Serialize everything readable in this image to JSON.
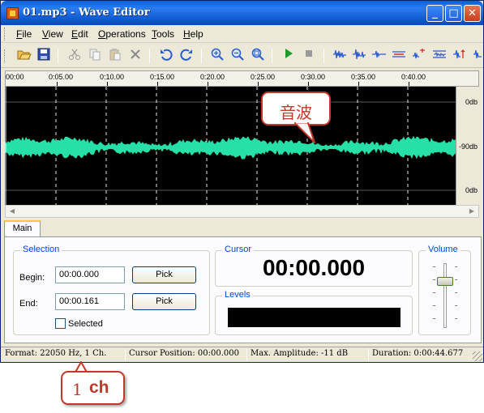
{
  "window": {
    "title": "01.mp3 - Wave Editor",
    "buttons": {
      "minimize": "_",
      "maximize": "□",
      "close": "✕"
    }
  },
  "menu": [
    {
      "label": "File",
      "accel": "F",
      "rest": "ile"
    },
    {
      "label": "View",
      "accel": "V",
      "rest": "iew"
    },
    {
      "label": "Edit",
      "accel": "E",
      "rest": "dit"
    },
    {
      "label": "Operations",
      "accel": "O",
      "rest": "perations"
    },
    {
      "label": "Tools",
      "accel": "T",
      "rest": "ools"
    },
    {
      "label": "Help",
      "accel": "H",
      "rest": "elp"
    }
  ],
  "toolbar": {
    "icons": [
      "open-icon",
      "save-icon",
      "cut-icon",
      "copy-icon",
      "paste-icon",
      "delete-icon",
      "undo-icon",
      "redo-icon",
      "zoom-in-icon",
      "zoom-out-icon",
      "zoom-fit-icon",
      "play-icon",
      "stop-icon",
      "wave-effect-icon"
    ]
  },
  "ruler": {
    "ticks": [
      "00:00",
      "0:05.00",
      "0:10.00",
      "0:15.00",
      "0:20.00",
      "0:25.00",
      "0:30.00",
      "0:35.00",
      "0:40.00"
    ]
  },
  "waveform": {
    "color": "#27e0a8",
    "db_labels": [
      "0db",
      "-90db",
      "0db"
    ]
  },
  "tabs": [
    "Main"
  ],
  "selection": {
    "title": "Selection",
    "begin_label": "Begin:",
    "begin_value": "00:00.000",
    "end_label": "End:",
    "end_value": "00:00.161",
    "pick_label": "Pick",
    "selected_label": "Selected",
    "selected_checked": false
  },
  "cursor": {
    "title": "Cursor",
    "value": "00:00.000"
  },
  "levels": {
    "title": "Levels"
  },
  "volume": {
    "title": "Volume",
    "level": 0.75
  },
  "status": {
    "format": "Format: 22050 Hz, 1 Ch.",
    "cursor_position": "Cursor Position: 00:00.000",
    "max_amplitude": "Max. Amplitude: -11 dB",
    "duration": "Duration: 0:00:44.677"
  },
  "annotations": {
    "wave_callout": "音波",
    "channel_callout_num": "1",
    "channel_callout_unit": "ch",
    "accent": "#c0392b"
  }
}
